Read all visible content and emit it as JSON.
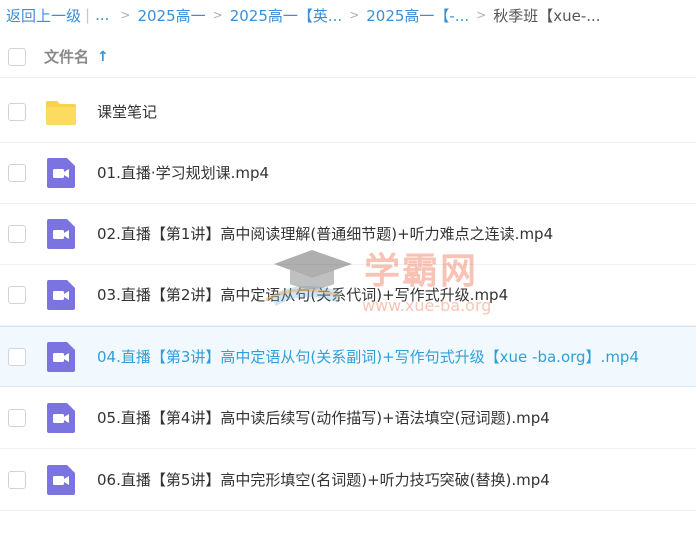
{
  "breadcrumb": {
    "back": "返回上一级",
    "separator": "|",
    "ellipsis": "...",
    "items": [
      "2025高一",
      "2025高一【英...",
      "2025高一【-...",
      "秋季班【xue-..."
    ]
  },
  "header": {
    "column_name": "文件名",
    "sort_glyph": "↑"
  },
  "files": [
    {
      "type": "folder",
      "name": "课堂笔记"
    },
    {
      "type": "video",
      "name": "01.直播·学习规划课.mp4"
    },
    {
      "type": "video",
      "name": "02.直播【第1讲】高中阅读理解(普通细节题)+听力难点之连读.mp4"
    },
    {
      "type": "video",
      "name": "03.直播【第2讲】高中定语从句(关系代词)+写作式升级.mp4"
    },
    {
      "type": "video",
      "name": "04.直播【第3讲】高中定语从句(关系副词)+写作句式升级【xue -ba.org】.mp4"
    },
    {
      "type": "video",
      "name": "05.直播【第4讲】高中读后续写(动作描写)+语法填空(冠词题).mp4"
    },
    {
      "type": "video",
      "name": "06.直播【第5讲】高中完形填空(名词题)+听力技巧突破(替换).mp4"
    }
  ],
  "watermark": {
    "text": "学霸网",
    "url": "www.xue-ba.org"
  },
  "colors": {
    "accent": "#3b8fd8",
    "folder": "#f8d24a",
    "video": "#7b74e0",
    "hover_row": "#f2f9fe"
  }
}
